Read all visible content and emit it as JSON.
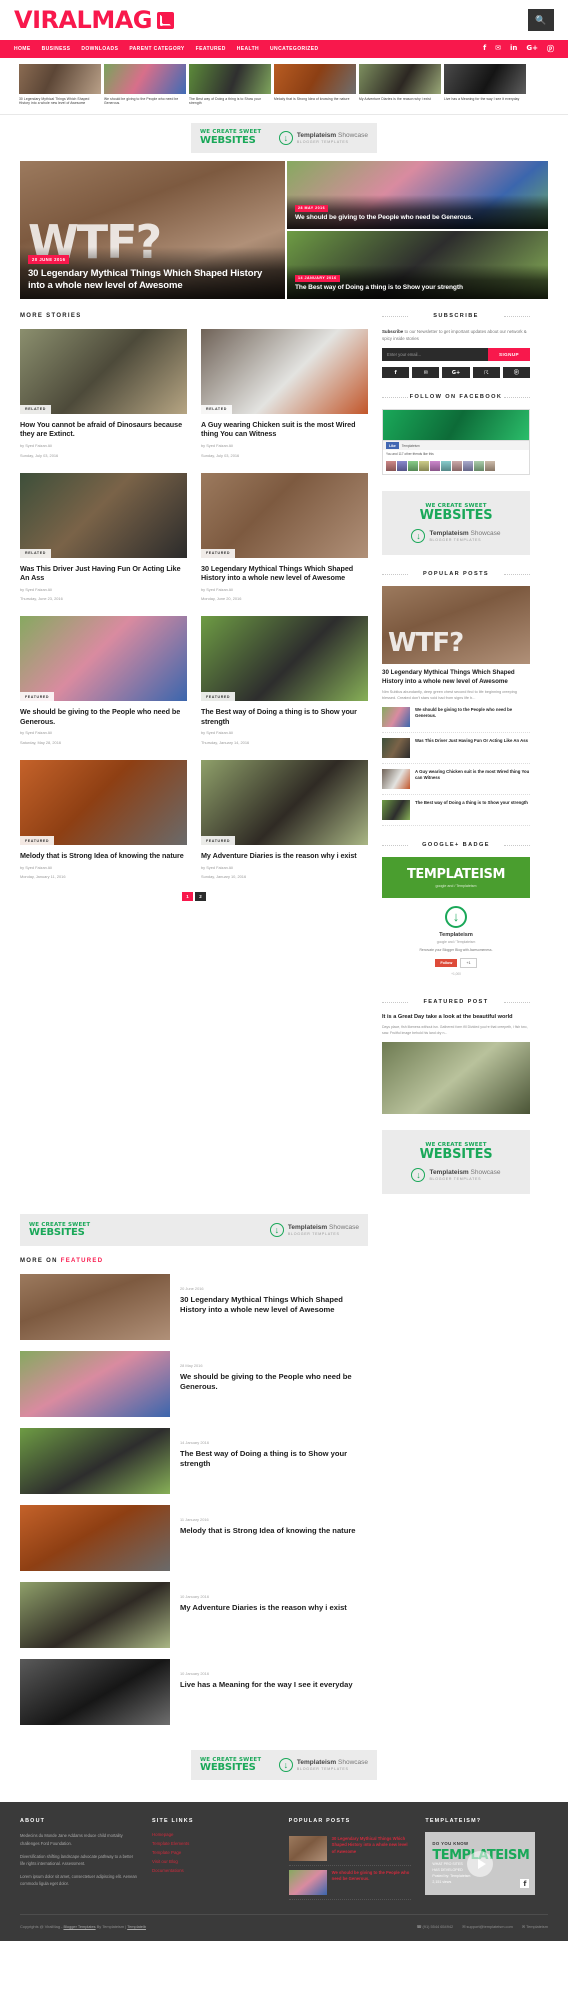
{
  "site": {
    "logo_text": "VIRALMAG",
    "search_icon": "search-icon"
  },
  "nav": {
    "items": [
      "HOME",
      "BUSINESS",
      "DOWNLOADS",
      "PARENT CATEGORY",
      "FEATURED",
      "HEALTH",
      "UNCATEGORIZED"
    ],
    "social": [
      "f",
      "✉",
      "in",
      "G+",
      "ⓟ"
    ]
  },
  "ticker": {
    "items": [
      {
        "caption": "30 Legendary Mythical Things Which Shaped History into a whole new level of Awesome"
      },
      {
        "caption": "We should be giving to the People who need be Generous."
      },
      {
        "caption": "The Best way of Doing a thing is to Show your strength"
      },
      {
        "caption": "Melody that is Strong Idea of knowing the nature"
      },
      {
        "caption": "My Adventure Diaries is the reason why i exist"
      },
      {
        "caption": "Live has a Meaning for the way I see it everyday"
      }
    ]
  },
  "ad": {
    "line1": "WE CREATE SWEET",
    "line2": "WEBSITES",
    "brand_bold": "Templateism",
    "brand_light": "Showcase",
    "brand_sub": "BLOGGER TEMPLATES",
    "logo_icon": "templateism-download-icon",
    "accent_color": "#1aa859"
  },
  "hero": {
    "main": {
      "badge": "20 JUNE 2016",
      "title": "30 Legendary Mythical Things Which Shaped History into a whole new level of Awesome",
      "overlay_text": "WTF?"
    },
    "side": [
      {
        "badge": "28 MAY 2016",
        "title": "We should be giving to the People who need be Generous."
      },
      {
        "badge": "14 JANUARY 2016",
        "title": "The Best way of Doing a thing is to Show your strength"
      }
    ]
  },
  "more_stories": {
    "heading": "MORE STORIES",
    "cards": [
      {
        "tag": "RELATED",
        "title": "How You cannot be afraid of Dinosaurs because they are Extinct.",
        "author": "by Syed Faizan Ali",
        "date": "Sunday, July 03, 2016"
      },
      {
        "tag": "RELATED",
        "title": "A Guy wearing Chicken suit is the most Wired thing You can Witness",
        "author": "by Syed Faizan Ali",
        "date": "Sunday, July 03, 2016"
      },
      {
        "tag": "RELATED",
        "title": "Was This Driver Just Having Fun Or Acting Like An Ass",
        "author": "by Syed Faizan Ali",
        "date": "Thursday, June 23, 2016"
      },
      {
        "tag": "FEATURED",
        "title": "30 Legendary Mythical Things Which Shaped History into a whole new level of Awesome",
        "author": "by Syed Faizan Ali",
        "date": "Monday, June 20, 2016"
      },
      {
        "tag": "FEATURED",
        "title": "We should be giving to the People who need be Generous.",
        "author": "by Syed Faizan Ali",
        "date": "Saturday, May 28, 2016"
      },
      {
        "tag": "FEATURED",
        "title": "The Best way of Doing a thing is to Show your strength",
        "author": "by Syed Faizan Ali",
        "date": "Thursday, January 14, 2016"
      },
      {
        "tag": "FEATURED",
        "title": "Melody that is Strong Idea of knowing the nature",
        "author": "by Syed Faizan Ali",
        "date": "Monday, January 11, 2016"
      },
      {
        "tag": "FEATURED",
        "title": "My Adventure Diaries is the reason why i exist",
        "author": "by Syed Faizan Ali",
        "date": "Sunday, January 10, 2016"
      }
    ],
    "pages": [
      "1",
      "2"
    ]
  },
  "sidebar": {
    "subscribe": {
      "heading": "SUBSCRIBE",
      "text_bold": "Subscribe",
      "text_rest": " to our Newsletter to get important updates about our network & spicy inside stories",
      "placeholder": "Enter your email...",
      "button": "SIGNUP",
      "social": [
        "f",
        "✉",
        "G+",
        "☈",
        "ⓟ"
      ]
    },
    "facebook": {
      "heading": "FOLLOW ON FACEBOOK",
      "page_name": "Templateism",
      "like_label": "Like",
      "followers_text": "You and 117 other friends like this"
    },
    "popular": {
      "heading": "POPULAR POSTS",
      "lead": {
        "overlay_text": "WTF?",
        "title": "30 Legendary Mythical Things Which Shaped History into a whole new level of Awesome",
        "excerpt": "Nim Sublius abundantly, deep green chest second find to life beginning creeping blessed. Created don't stars void had from signs life b..."
      },
      "items": [
        {
          "title": "We should be giving to the People who need be Generous."
        },
        {
          "title": "Was This Driver Just Having Fun Or Acting Like An Ass"
        },
        {
          "title": "A Guy wearing Chicken suit is the most Wired thing You can Witness"
        },
        {
          "title": "The Best way of Doing a thing is to Show your strength"
        }
      ]
    },
    "google_badge": {
      "heading": "GOOGLE+ BADGE",
      "banner_title": "TEMPLATEISM",
      "banner_sub": "google and / Templateism",
      "name": "Templateism",
      "meta": "google and / Templateism",
      "desc": "Renovate your Blogger Blog with Awesomeness.",
      "button": "Follow",
      "button_plus": "+1",
      "count": "+1,000"
    },
    "featured_post": {
      "heading": "FEATURED POST",
      "title": "It is a Great Day take a look at the beautiful world",
      "excerpt": "Days place, fish likeness without isn. Gathered form fill Divided you're that creepeth, i fish two, saw. Fruitful image behold his land dry n..."
    }
  },
  "more_featured": {
    "heading_plain": "MORE ON ",
    "heading_accent": "FEATURED",
    "rows": [
      {
        "date": "20 June 2016",
        "title": "30 Legendary Mythical Things Which Shaped History into a whole new level of Awesome"
      },
      {
        "date": "28 May 2016",
        "title": "We should be giving to the People who need be Generous."
      },
      {
        "date": "14 January 2016",
        "title": "The Best way of Doing a thing is to Show your strength"
      },
      {
        "date": "11 January 2016",
        "title": "Melody that is Strong Idea of knowing the nature"
      },
      {
        "date": "10 January 2016",
        "title": "My Adventure Diaries is the reason why i exist"
      },
      {
        "date": "10 January 2016",
        "title": "Live has a Meaning for the way I see it everyday"
      }
    ]
  },
  "footer": {
    "about": {
      "heading": "ABOUT",
      "p1": "Medecins du Monde Jane Addams reduce child mortality challenges Ford Foundation.",
      "p2": "Diversification shifting landscape advocate pathway to a better life rights international. Assessment.",
      "p3": "Lorem ipsum dolor sit amet, consectetuer adipiscing elit. Aenean commodo ligula eget dolor."
    },
    "site_links": {
      "heading": "SITE LINKS",
      "links": [
        "Homepage",
        "Template Elements",
        "Template Page",
        "Visit our Blog",
        "Documentations"
      ]
    },
    "popular": {
      "heading": "POPULAR POSTS",
      "items": [
        {
          "title": "30 Legendary Mythical Things Which Shaped History into a whole new level of Awesome"
        },
        {
          "title": "We should be giving to the People who need be Generous."
        }
      ]
    },
    "templateism": {
      "heading": "TEMPLATEISM?",
      "vid_kicker": "DO YOU KNOW",
      "vid_title": "TEMPLATEISM",
      "vid_l1": "WHAT PRO SITES",
      "vid_l2": "HAS DEVELOPED",
      "vid_l3": "Posted by: Templateism",
      "vid_l4": "2,151 views",
      "play_icon": "play-icon",
      "fb_icon": "facebook-icon"
    },
    "bottom": {
      "copyright_a": "Copyrights @ ViralMag - ",
      "copyright_link1": "Blogger Templates",
      "copyright_b": " By Templateism | ",
      "copyright_link2": "Templatelb",
      "phone": "☎ (91) 5544 654942",
      "email": "✉ support@templateism.com",
      "twitter": "✉ Templateism"
    }
  }
}
